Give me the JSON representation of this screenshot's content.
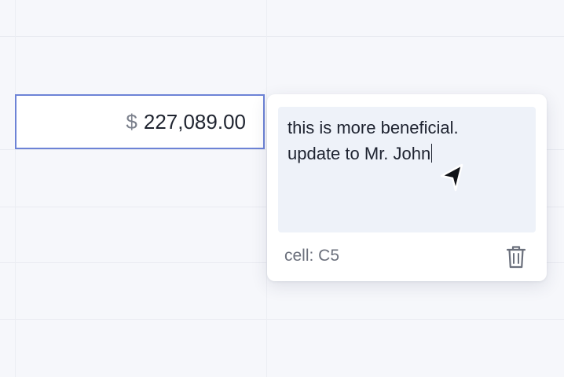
{
  "cell": {
    "currency_symbol": "$",
    "value": "227,089.00"
  },
  "comment": {
    "line1": "this is more beneficial.",
    "line2": "update to Mr. John",
    "cell_ref": "cell: C5"
  },
  "icons": {
    "send": "send-icon",
    "delete": "trash-icon"
  },
  "colors": {
    "selection_border": "#6d83d6",
    "textarea_bg": "#eef2f9",
    "text": "#1e2330",
    "muted_text": "#6b707c"
  }
}
